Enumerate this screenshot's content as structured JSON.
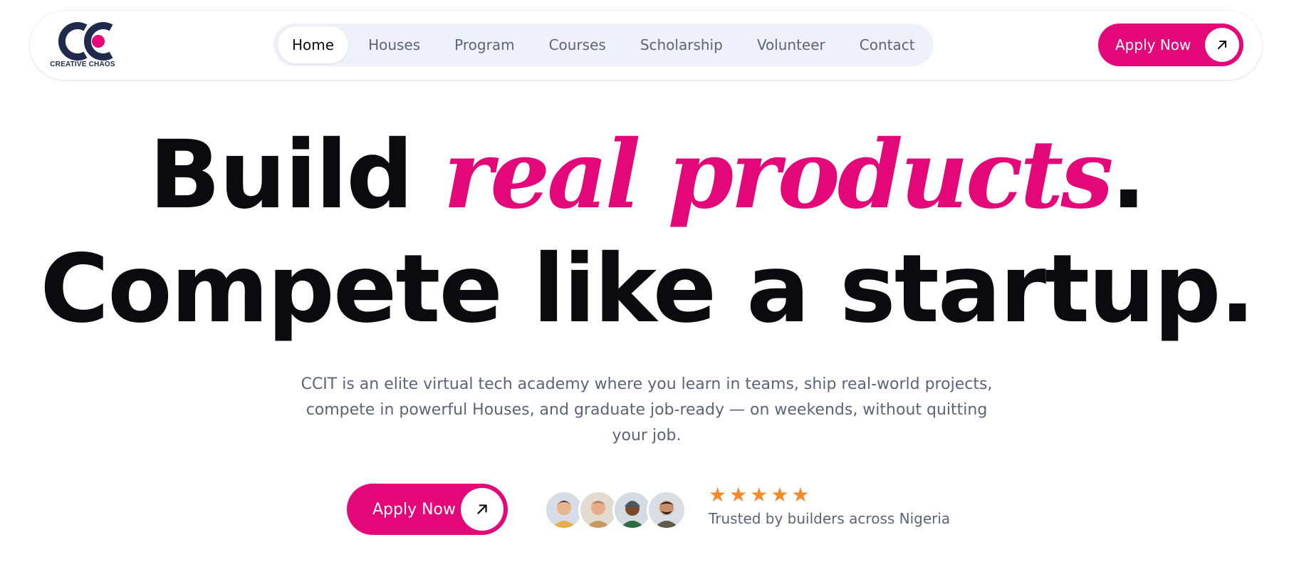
{
  "brand": {
    "logo_text": "CREATIVE CHAOS",
    "accent_color": "#e4077a",
    "navy_color": "#1f2b4d"
  },
  "nav": {
    "items": [
      {
        "label": "Home",
        "active": true
      },
      {
        "label": "Houses"
      },
      {
        "label": "Program"
      },
      {
        "label": "Courses"
      },
      {
        "label": "Scholarship"
      },
      {
        "label": "Volunteer"
      },
      {
        "label": "Contact"
      }
    ]
  },
  "header": {
    "apply_label": "Apply Now"
  },
  "hero": {
    "line1_pre": "Build ",
    "line1_accent": "real products",
    "line1_post": ".",
    "line2": "Compete like a startup.",
    "subtext": "CCIT is an elite virtual tech academy where you learn in teams, ship real-world projects, compete in powerful Houses, and graduate job-ready — on weekends, without quitting your job.",
    "apply_label": "Apply Now",
    "rating_stars": 5,
    "trusted_text": "Trusted by builders across Nigeria"
  },
  "icons": {
    "button_arrow": "arrow-up-right-icon",
    "rating": "star-icon"
  }
}
